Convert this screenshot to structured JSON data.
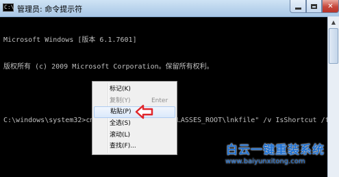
{
  "window": {
    "title": "管理员: 命令提示符",
    "icon_text": "C:\\"
  },
  "console": {
    "lines": [
      "Microsoft Windows [版本 6.1.7601]",
      "版权所有 (c) 2009 Microsoft Corporation。保留所有权利。",
      "",
      "C:\\windows\\system32>cmd /k reg add \"HKEY_CLASSES_ROOT\\lnkfile\" /v IsShortcut /f"
    ]
  },
  "context_menu": {
    "items": [
      {
        "label": "标记(K)",
        "state": "normal"
      },
      {
        "label": "复制(Y)",
        "shortcut": "Enter",
        "state": "disabled"
      },
      {
        "label": "粘贴(P)",
        "state": "highlighted"
      },
      {
        "label": "全选(S)",
        "state": "normal"
      },
      {
        "label": "滚动(L)",
        "state": "normal"
      },
      {
        "label": "查找(F)...",
        "state": "normal"
      }
    ]
  },
  "watermark": {
    "title": "白云一键重装系统",
    "url": "www.baiyunxitong.com"
  },
  "colors": {
    "console_bg": "#000000",
    "console_text": "#c0c0c0",
    "annotation_arrow": "#e0262b",
    "watermark": "#1e6fd0"
  }
}
